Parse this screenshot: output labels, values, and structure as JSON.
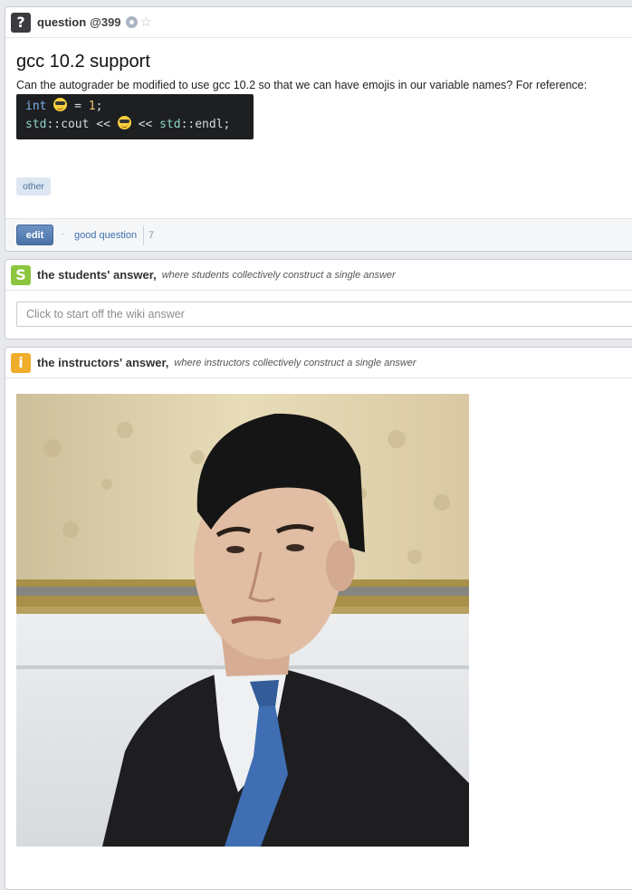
{
  "question": {
    "header_label": "question",
    "number": "@399",
    "icon": "question-mark-icon",
    "title": "gcc 10.2 support",
    "body": "Can the autograder be modified to use gcc 10.2 so that we can have emojis in our variable names? For reference:",
    "code": {
      "line1": {
        "keyword": "int",
        "rest": " = ",
        "number": "1",
        "end": ";"
      },
      "line2": {
        "ns1": "std",
        "op1": "::cout << ",
        "op2": " << ",
        "ns2": "std",
        "end": "::endl;"
      }
    },
    "tag": "other",
    "edit_label": "edit",
    "good_question_label": "good question",
    "good_question_count": "7"
  },
  "students_answer": {
    "badge": "S",
    "title": "the students' answer,",
    "subtitle": "where students collectively construct a single answer",
    "placeholder": "Click to start off the wiki answer"
  },
  "instructors_answer": {
    "badge": "i",
    "title": "the instructors' answer,",
    "subtitle": "where instructors collectively construct a single answer"
  },
  "colors": {
    "student_badge": "#8cc63f",
    "instructor_badge": "#f0ad2b",
    "link": "#3b6fb0"
  }
}
